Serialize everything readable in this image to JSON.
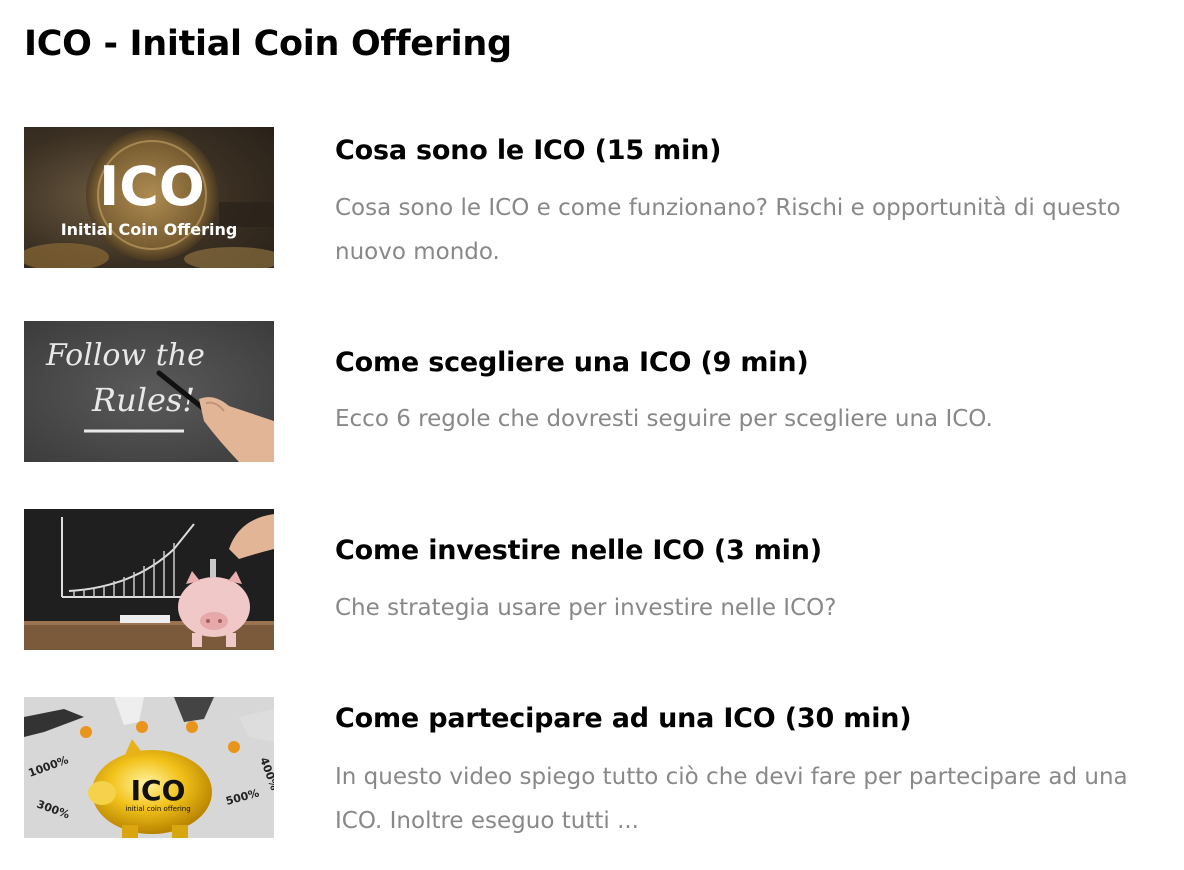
{
  "page": {
    "title": "ICO - Initial Coin Offering"
  },
  "lessons": [
    {
      "title": "Cosa sono le ICO (15 min)",
      "description": "Cosa sono le ICO e come funzionano? Rischi e opportunità di questo nuovo mondo.",
      "thumbnail": {
        "icon": "ico-coin-image",
        "big_text": "ICO",
        "small_text": "Initial Coin Offering"
      }
    },
    {
      "title": "Come scegliere una ICO (9 min)",
      "description": "Ecco 6 regole che dovresti seguire per scegliere una ICO.",
      "thumbnail": {
        "icon": "follow-the-rules-chalkboard-image",
        "line1": "Follow the",
        "line2": "Rules!"
      }
    },
    {
      "title": "Come investire nelle ICO (3 min)",
      "description": "Che strategia usare per investire nelle ICO?",
      "thumbnail": {
        "icon": "piggy-bank-growth-chart-image"
      }
    },
    {
      "title": "Come partecipare ad una ICO (30 min)",
      "description": "In questo video spiego tutto ciò che devi fare per partecipare ad una ICO. Inoltre eseguo tutti ...",
      "thumbnail": {
        "icon": "golden-piggy-bank-image",
        "big_text": "ICO",
        "small_text": "initial coin offering",
        "labels": [
          "1000%",
          "300%",
          "500%",
          "400%"
        ]
      }
    }
  ]
}
